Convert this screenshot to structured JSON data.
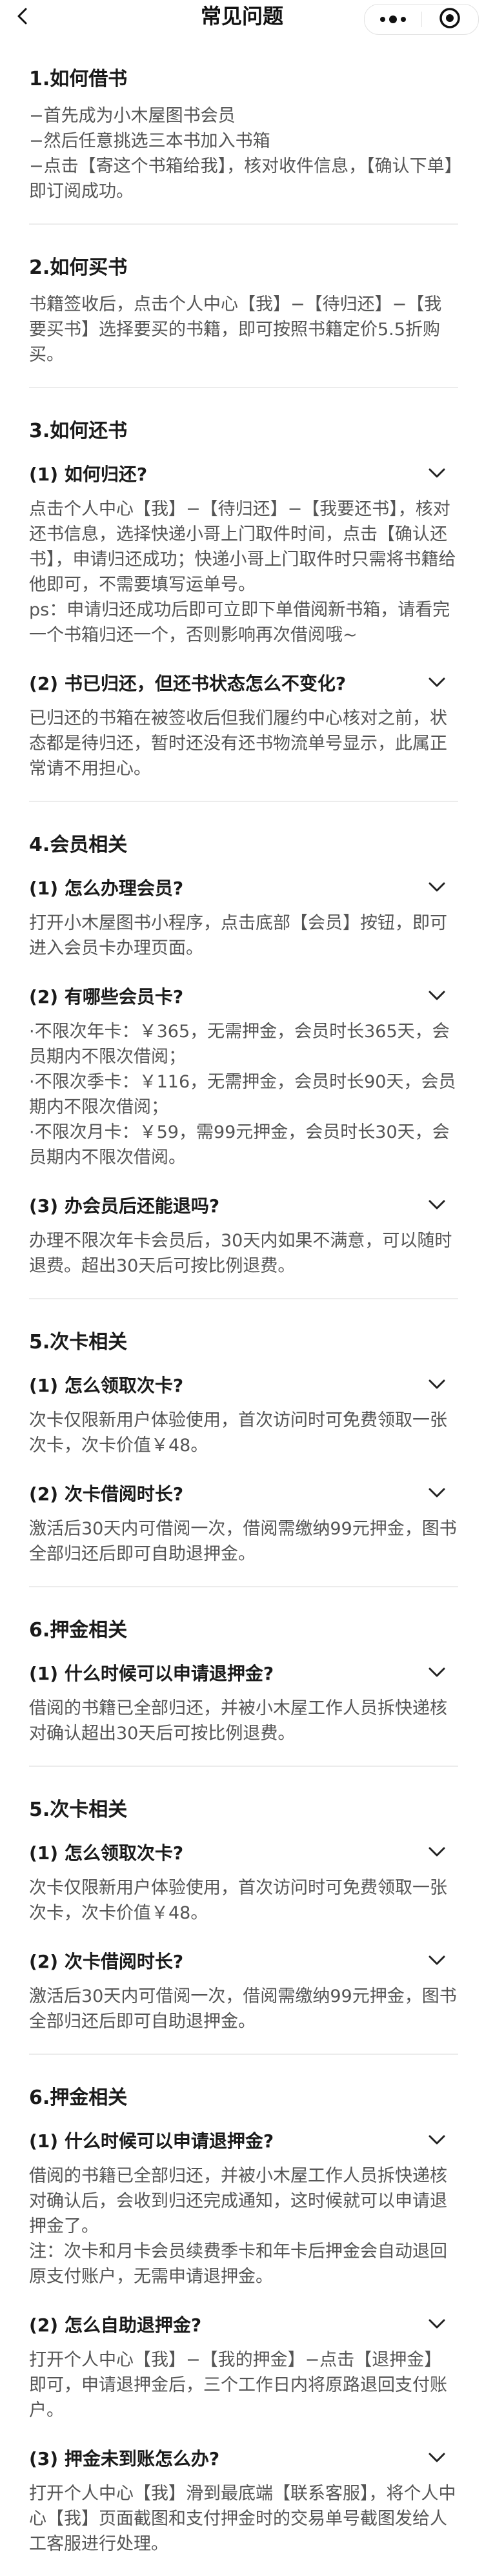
{
  "nav": {
    "title": "常见问题"
  },
  "sections": [
    {
      "title": "1.如何借书",
      "lines": [
        "−首先成为小木屋图书会员",
        "−然后任意挑选三本书加入书箱",
        "−点击【寄这个书箱给我】，核对收件信息，【确认下单】即订阅成功。"
      ]
    },
    {
      "title": "2.如何买书",
      "lines": [
        "书籍签收后，点击个人中心【我】−【待归还】−【我要买书】选择要买的书籍，即可按照书籍定价5.5折购买。"
      ]
    },
    {
      "title": "3.如何还书",
      "questions": [
        {
          "q": "(1) 如何归还?",
          "a": [
            "点击个人中心【我】−【待归还】−【我要还书】，核对还书信息，选择快递小哥上门取件时间，点击【确认还书】，申请归还成功；快递小哥上门取件时只需将书籍给他即可，不需要填写运单号。",
            "ps：申请归还成功后即可立即下单借阅新书箱，请看完一个书箱归还一个，否则影响再次借阅哦~"
          ]
        },
        {
          "q": "(2) 书已归还，但还书状态怎么不变化?",
          "a": [
            "已归还的书箱在被签收后但我们履约中心核对之前，状态都是待归还，暂时还没有还书物流单号显示，此属正常请不用担心。"
          ]
        }
      ]
    },
    {
      "title": "4.会员相关",
      "questions": [
        {
          "q": "(1) 怎么办理会员?",
          "a": [
            "打开小木屋图书小程序，点击底部【会员】按钮，即可进入会员卡办理页面。"
          ]
        },
        {
          "q": "(2) 有哪些会员卡?",
          "a": [
            "·不限次年卡：￥365，无需押金，会员时长365天，会员期内不限次借阅；",
            "·不限次季卡：￥116，无需押金，会员时长90天，会员期内不限次借阅；",
            "·不限次月卡：￥59，需99元押金，会员时长30天，会员期内不限次借阅。"
          ]
        },
        {
          "q": "(3) 办会员后还能退吗?",
          "a": [
            "办理不限次年卡会员后，30天内如果不满意，可以随时退费。超出30天后可按比例退费。"
          ]
        }
      ]
    },
    {
      "title": "5.次卡相关",
      "questions": [
        {
          "q": "(1) 怎么领取次卡?",
          "a": [
            "次卡仅限新用户体验使用，首次访问时可免费领取一张次卡，次卡价值￥48。"
          ]
        },
        {
          "q": "(2) 次卡借阅时长?",
          "a": [
            "激活后30天内可借阅一次，借阅需缴纳99元押金，图书全部归还后即可自助退押金。"
          ]
        }
      ]
    },
    {
      "title": "6.押金相关",
      "questions": [
        {
          "q": "(1) 什么时候可以申请退押金?",
          "a": [
            "借阅的书籍已全部归还，并被小木屋工作人员拆快递核对确认超出30天后可按比例退费。"
          ]
        }
      ]
    },
    {
      "title": "5.次卡相关",
      "questions": [
        {
          "q": "(1) 怎么领取次卡?",
          "a": [
            "次卡仅限新用户体验使用，首次访问时可免费领取一张次卡，次卡价值￥48。"
          ]
        },
        {
          "q": "(2) 次卡借阅时长?",
          "a": [
            "激活后30天内可借阅一次，借阅需缴纳99元押金，图书全部归还后即可自助退押金。"
          ]
        }
      ]
    },
    {
      "title": "6.押金相关",
      "questions": [
        {
          "q": "(1) 什么时候可以申请退押金?",
          "a": [
            "借阅的书籍已全部归还，并被小木屋工作人员拆快递核对确认后，会收到归还完成通知，这时候就可以申请退押金了。",
            "注：次卡和月卡会员续费季卡和年卡后押金会自动退回原支付账户，无需申请退押金。"
          ]
        },
        {
          "q": "(2) 怎么自助退押金?",
          "a": [
            "打开个人中心【我】−【我的押金】−点击【退押金】即可，申请退押金后，三个工作日内将原路退回支付账户。"
          ]
        },
        {
          "q": "(3) 押金未到账怎么办?",
          "a": [
            "打开个人中心【我】滑到最底端【联系客服】，将个人中心【我】页面截图和支付押金时的交易单号截图发给人工客服进行处理。"
          ]
        }
      ]
    }
  ]
}
